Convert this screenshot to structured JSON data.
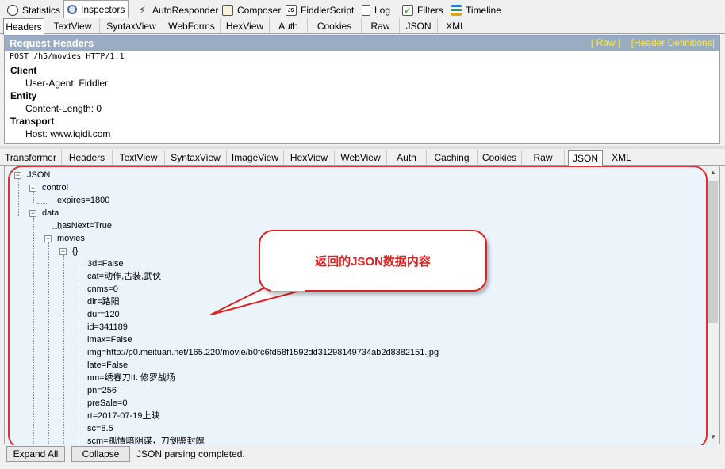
{
  "top_tabs": [
    {
      "label": "Statistics",
      "icon": "stopwatch-icon"
    },
    {
      "label": "Inspectors",
      "icon": "magnifier-icon"
    },
    {
      "label": "AutoResponder",
      "icon": "lightning-icon"
    },
    {
      "label": "Composer",
      "icon": "pencil-icon"
    },
    {
      "label": "FiddlerScript",
      "icon": "script-icon"
    },
    {
      "label": "Log",
      "icon": "log-icon"
    },
    {
      "label": "Filters",
      "icon": "checkbox-icon"
    },
    {
      "label": "Timeline",
      "icon": "timeline-icon"
    }
  ],
  "request_tabs": [
    "Headers",
    "TextView",
    "SyntaxView",
    "WebForms",
    "HexView",
    "Auth",
    "Cookies",
    "Raw",
    "JSON",
    "XML"
  ],
  "request_headers": {
    "title": "Request Headers",
    "raw_link": "[ Raw ]",
    "defs_link": "[Header Definitions]",
    "request_line": "POST /h5/movies HTTP/1.1",
    "groups": [
      {
        "name": "Client",
        "items": [
          "User-Agent: Fiddler"
        ]
      },
      {
        "name": "Entity",
        "items": [
          "Content-Length: 0"
        ]
      },
      {
        "name": "Transport",
        "items": [
          "Host: www.iqidi.com"
        ]
      }
    ]
  },
  "response_tabs": [
    "Transformer",
    "Headers",
    "TextView",
    "SyntaxView",
    "ImageView",
    "HexView",
    "WebView",
    "Auth",
    "Caching",
    "Cookies",
    "Raw",
    "JSON",
    "XML"
  ],
  "json_tree": {
    "root": "JSON",
    "control": "control",
    "expires": "expires=1800",
    "data": "data",
    "hasNext": "hasNext=True",
    "movies": "movies",
    "obj": "{}",
    "fields": [
      "3d=False",
      "cat=动作,古装,武侠",
      "cnms=0",
      "dir=路阳",
      "dur=120",
      "id=341189",
      "imax=False",
      "img=http://p0.meituan.net/165.220/movie/b0fc6fd58f1592dd31298149734ab2d8382151.jpg",
      "late=False",
      "nm=绣春刀II: 修罗战场",
      "pn=256",
      "preSale=0",
      "rt=2017-07-19上映",
      "sc=8.5",
      "scm=孤情暗阴谋，刀剑鉴封魄"
    ]
  },
  "callout_text": "返回的JSON数据内容",
  "buttons": {
    "expand_all": "Expand All",
    "collapse": "Collapse"
  },
  "status": "JSON parsing completed.",
  "colors": {
    "accent_red": "#e02020",
    "header_bar": "#9aacc4",
    "tree_bg": "#ebf3fb",
    "link_yellow": "#ffeb3b"
  }
}
